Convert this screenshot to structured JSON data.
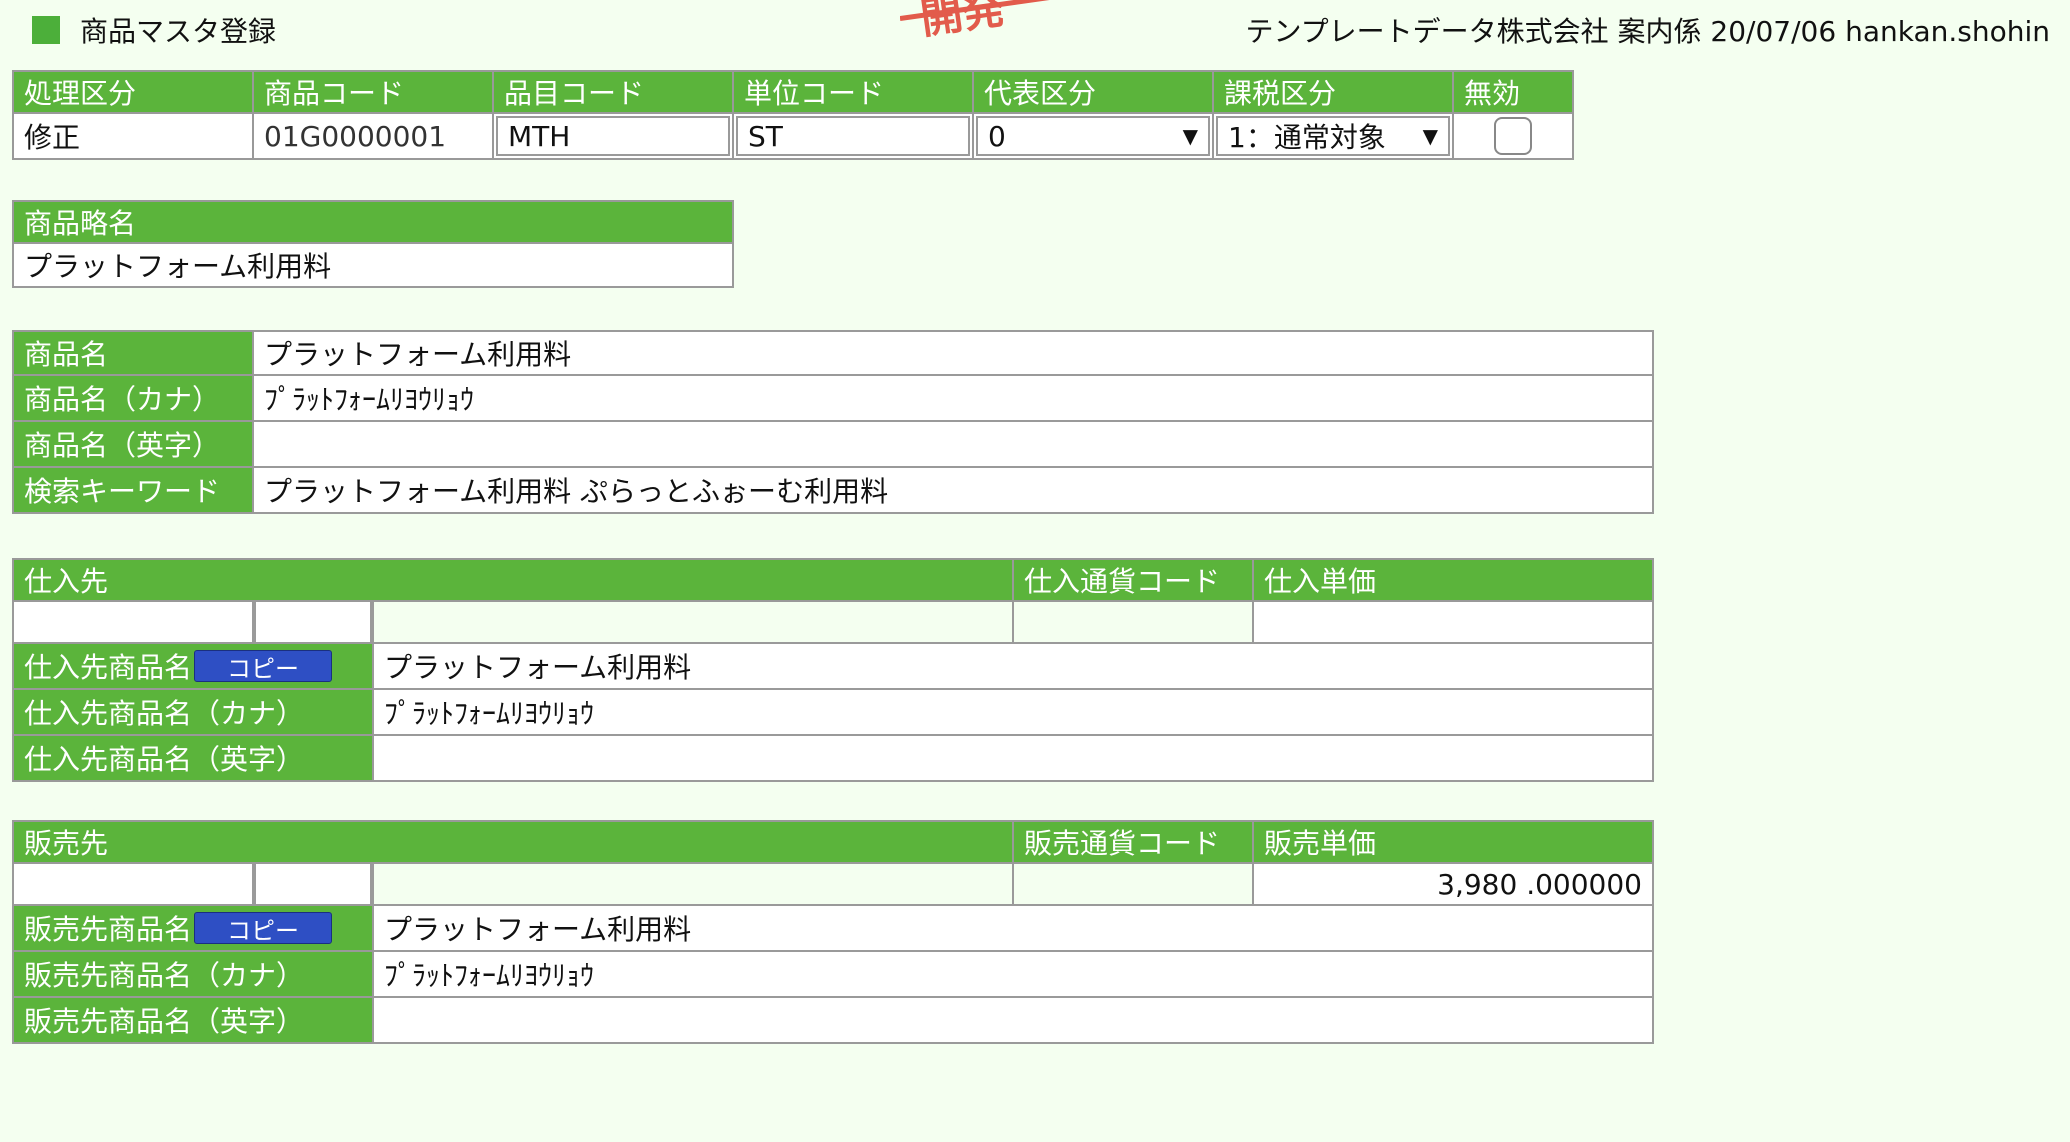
{
  "app": {
    "title": "商品マスタ登録",
    "status_line": "テンプレートデータ株式会社 案内係 20/07/06 hankan.shohin",
    "stamp_text": "開発"
  },
  "top": {
    "headers": [
      "処理区分",
      "商品コード",
      "品目コード",
      "単位コード",
      "代表区分",
      "課税区分",
      "無効"
    ],
    "mode": "修正",
    "product_code": "01G0000001",
    "item_code": "MTH",
    "unit_code": "ST",
    "rep_category": "0",
    "tax_category": "1：通常対象",
    "invalid_checked": false
  },
  "short_name": {
    "label": "商品略名",
    "value": "プラットフォーム利用料"
  },
  "names": {
    "name_label": "商品名",
    "name_value": "プラットフォーム利用料",
    "kana_label": "商品名（カナ）",
    "kana_value": "ﾌﾟﾗｯﾄﾌｫｰﾑﾘﾖｳﾘｮｳ",
    "en_label": "商品名（英字）",
    "en_value": "",
    "kw_label": "検索キーワード",
    "kw_value": "プラットフォーム利用料 ぷらっとふぉーむ利用料"
  },
  "supplier": {
    "header": "仕入先",
    "currency_header": "仕入通貨コード",
    "price_header": "仕入単価",
    "code1": "",
    "code2": "",
    "name": "",
    "currency": "",
    "price": "",
    "item_name_label": "仕入先商品名",
    "item_name_value": "プラットフォーム利用料",
    "kana_label": "仕入先商品名（カナ）",
    "kana_value": "ﾌﾟﾗｯﾄﾌｫｰﾑﾘﾖｳﾘｮｳ",
    "en_label": "仕入先商品名（英字）",
    "en_value": "",
    "copy_label": "コピー"
  },
  "customer": {
    "header": "販売先",
    "currency_header": "販売通貨コード",
    "price_header": "販売単価",
    "code1": "",
    "code2": "",
    "name": "",
    "currency": "",
    "price": "3,980 .000000",
    "item_name_label": "販売先商品名",
    "item_name_value": "プラットフォーム利用料",
    "kana_label": "販売先商品名（カナ）",
    "kana_value": "ﾌﾟﾗｯﾄﾌｫｰﾑﾘﾖｳﾘｮｳ",
    "en_label": "販売先商品名（英字）",
    "en_value": "",
    "copy_label": "コピー"
  },
  "colors": {
    "header_green": "#5bb43b",
    "background": "#f4fff0",
    "copy_button": "#2e4fc4",
    "stamp": "#e25b4b"
  }
}
